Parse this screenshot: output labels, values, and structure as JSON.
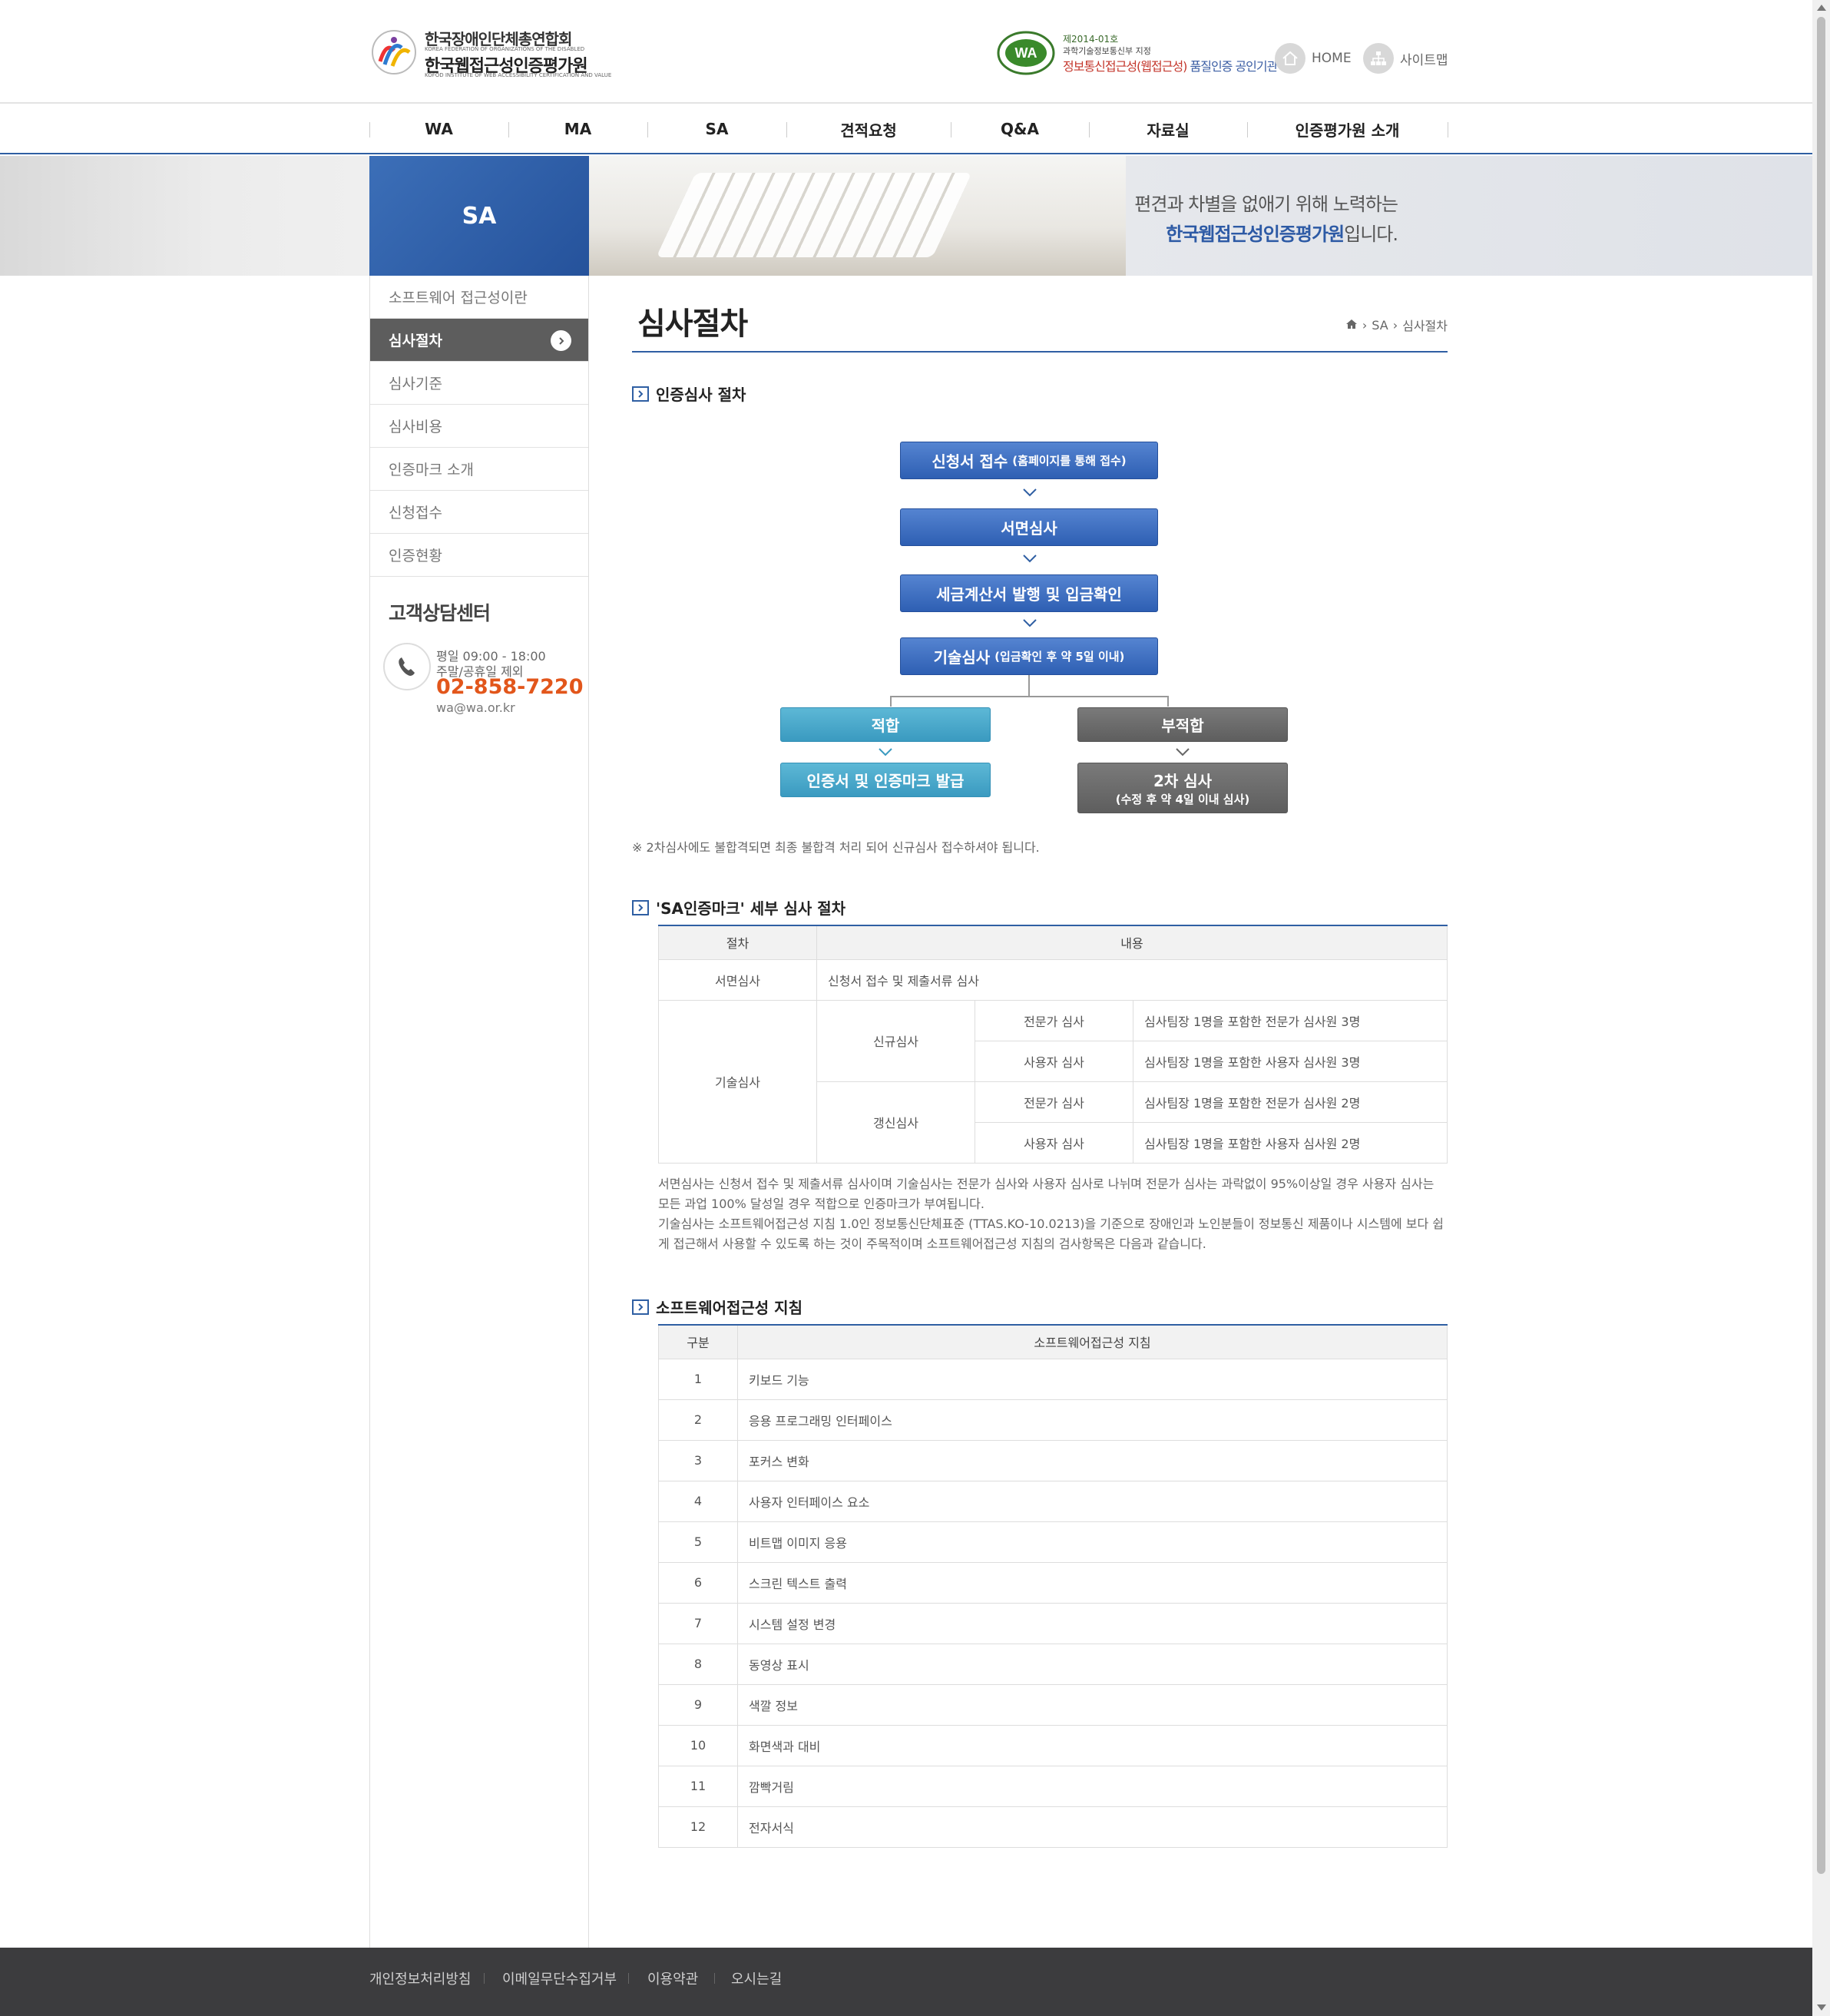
{
  "header": {
    "logo_line1": "한국장애인단체총연합회",
    "logo_line1_en": "KOREA FEDERATION OF ORGANIZATIONS OF THE DISABLED",
    "logo_line2": "한국웹접근성인증평가원",
    "logo_line2_en": "KOFOD INSTITUTE OF WEB ACCESSIBILITY CERTIFICATION AND VALUE",
    "cert_line1": "제2014-01호",
    "cert_line2": "과학기술정보통신부 지정",
    "cert_line3_red": "정보통신접근성(웹접근성)",
    "cert_line3_blue": "품질인증 공인기관",
    "home_label": "HOME",
    "sitemap_label": "사이트맵"
  },
  "gnb": [
    "WA",
    "MA",
    "SA",
    "견적요청",
    "Q&A",
    "자료실",
    "인증평가원 소개"
  ],
  "visual": {
    "section_title": "SA",
    "slogan_line1": "편견과 차별을 없애기 위해 노력하는",
    "slogan_line2_bold": "한국웹접근성인증평가원",
    "slogan_line2_rest": "입니다."
  },
  "lnb": {
    "items": [
      {
        "label": "소프트웨어 접근성이란",
        "active": false
      },
      {
        "label": "심사절차",
        "active": true
      },
      {
        "label": "심사기준",
        "active": false
      },
      {
        "label": "심사비용",
        "active": false
      },
      {
        "label": "인증마크 소개",
        "active": false
      },
      {
        "label": "신청접수",
        "active": false
      },
      {
        "label": "인증현황",
        "active": false
      }
    ],
    "support": {
      "title": "고객상담센터",
      "hours1": "평일 09:00 - 18:00",
      "hours2": "주말/공휴일 제외",
      "tel": "02-858-7220",
      "email": "wa@wa.or.kr"
    }
  },
  "content": {
    "page_title": "심사절차",
    "breadcrumb": [
      "SA",
      "심사절차"
    ],
    "section1_title": "인증심사 절차",
    "flow": {
      "step1": "신청서 접수",
      "step1_sub": "(홈페이지를 통해 접수)",
      "step2": "서면심사",
      "step3": "세금계산서 발행 및 입금확인",
      "step4": "기술심사",
      "step4_sub": "(입금확인 후 약 5일 이내)",
      "pass": "적합",
      "fail": "부적합",
      "pass_next": "인증서 및 인증마크 발급",
      "fail_next_line1": "2차 심사",
      "fail_next_line2": "(수정 후 약 4일 이내 심사)"
    },
    "note": "※ 2차심사에도 불합격되면 최종 불합격 처리 되어 신규심사 접수하셔야 됩니다.",
    "section2_title": "'SA인증마크' 세부 심사 절차",
    "table1": {
      "headers": [
        "절차",
        "내용"
      ],
      "doc_review": "서면심사",
      "doc_review_desc": "신청서 접수 및 제출서류 심사",
      "tech_review": "기술심사",
      "new_review": "신규심사",
      "renew_review": "갱신심사",
      "expert": "전문가 심사",
      "user": "사용자 심사",
      "new_expert_desc": "심사팀장 1명을 포함한 전문가 심사원 3명",
      "new_user_desc": "심사팀장 1명을 포함한 사용자 심사원 3명",
      "renew_expert_desc": "심사팀장 1명을 포함한 전문가 심사원 2명",
      "renew_user_desc": "심사팀장 1명을 포함한 사용자 심사원 2명"
    },
    "desc1": "서면심사는 신청서 접수 및 제출서류 심사이며 기술심사는 전문가 심사와 사용자 심사로 나뉘며 전문가 심사는 과락없이 95%이상일 경우 사용자 심사는 모든 과업 100% 달성일 경우 적합으로 인증마크가 부여됩니다.",
    "desc2": "기술심사는 소프트웨어접근성 지침 1.0인 정보통신단체표준 (TTAS.KO-10.0213)을 기준으로 장애인과 노인분들이 정보통신 제품이나 시스템에 보다 쉽게 접근해서 사용할 수 있도록 하는 것이 주목적이며 소프트웨어접근성 지침의 검사항목은 다음과 같습니다.",
    "section3_title": "소프트웨어접근성 지침",
    "table2": {
      "headers": [
        "구분",
        "소프트웨어접근성 지침"
      ],
      "rows": [
        {
          "no": "1",
          "item": "키보드 기능"
        },
        {
          "no": "2",
          "item": "응용 프로그래밍 인터페이스"
        },
        {
          "no": "3",
          "item": "포커스 변화"
        },
        {
          "no": "4",
          "item": "사용자 인터페이스 요소"
        },
        {
          "no": "5",
          "item": "비트맵 이미지 응용"
        },
        {
          "no": "6",
          "item": "스크린 텍스트 출력"
        },
        {
          "no": "7",
          "item": "시스템 설정 변경"
        },
        {
          "no": "8",
          "item": "동영상 표시"
        },
        {
          "no": "9",
          "item": "색깔 정보"
        },
        {
          "no": "10",
          "item": "화면색과 대비"
        },
        {
          "no": "11",
          "item": "깜빡거림"
        },
        {
          "no": "12",
          "item": "전자서식"
        }
      ]
    }
  },
  "footer": {
    "links": [
      "개인정보처리방침",
      "이메일무단수집거부",
      "이용약관",
      "오시는길"
    ]
  },
  "colors": {
    "primary": "#2f5fa3",
    "accent_tel": "#e2561b",
    "footer_bg": "#3c3c3e"
  }
}
